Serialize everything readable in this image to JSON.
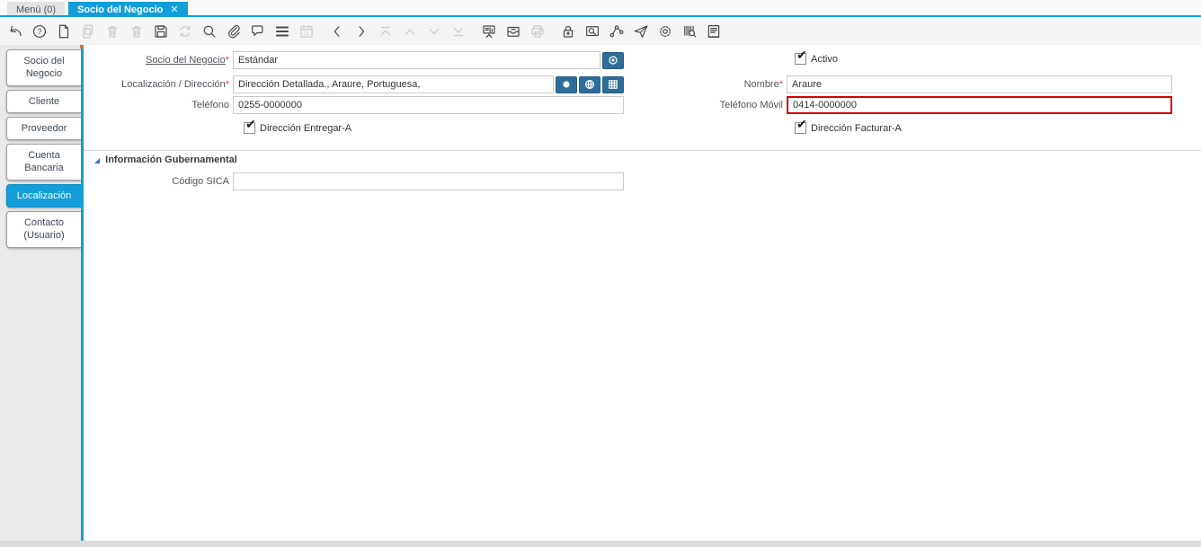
{
  "window": {
    "tabs": [
      {
        "label": "Menú (0)",
        "active": false
      },
      {
        "label": "Socio del Negocio",
        "active": true
      }
    ],
    "close_glyph": "✕"
  },
  "toolbar": {
    "icons": [
      {
        "name": "undo",
        "disabled": false
      },
      {
        "name": "help",
        "disabled": false
      },
      {
        "name": "new-record",
        "disabled": false
      },
      {
        "name": "copy-record",
        "disabled": true
      },
      {
        "name": "delete-record",
        "disabled": true
      },
      {
        "name": "delete-selection",
        "disabled": true
      },
      {
        "name": "save",
        "disabled": false
      },
      {
        "name": "refresh",
        "disabled": true
      },
      {
        "name": "find",
        "disabled": false
      },
      {
        "name": "attachment",
        "disabled": false
      },
      {
        "name": "chat",
        "disabled": false
      },
      {
        "name": "toggle-grid",
        "disabled": false
      },
      {
        "name": "calendar",
        "disabled": true
      },
      {
        "name": "previous-record",
        "disabled": false
      },
      {
        "name": "next-record",
        "disabled": false
      },
      {
        "name": "first-record",
        "disabled": true
      },
      {
        "name": "parent-record",
        "disabled": true
      },
      {
        "name": "detail-record",
        "disabled": true
      },
      {
        "name": "last-record",
        "disabled": true
      },
      {
        "name": "process",
        "disabled": false
      },
      {
        "name": "archive",
        "disabled": false
      },
      {
        "name": "print",
        "disabled": true
      },
      {
        "name": "lock",
        "disabled": false
      },
      {
        "name": "zoom-across",
        "disabled": false
      },
      {
        "name": "workflow",
        "disabled": false
      },
      {
        "name": "requests",
        "disabled": false
      },
      {
        "name": "preferences",
        "disabled": false
      },
      {
        "name": "product-info",
        "disabled": false
      },
      {
        "name": "report",
        "disabled": false
      }
    ]
  },
  "sidebar": {
    "tabs": [
      {
        "label": "Socio del Negocio",
        "active": false
      },
      {
        "label": "Cliente",
        "active": false
      },
      {
        "label": "Proveedor",
        "active": false
      },
      {
        "label": "Cuenta Bancaria",
        "active": false
      },
      {
        "label": "Localización",
        "active": true
      },
      {
        "label": "Contacto (Usuario)",
        "active": false
      }
    ]
  },
  "form": {
    "left": {
      "business_partner": {
        "label": "Socio del Negocio",
        "required": "*",
        "value": "Estándar"
      },
      "location": {
        "label": "Localización / Dirección",
        "required": "*",
        "value": "Dirección Detallada., Araure, Portuguesa,"
      },
      "phone": {
        "label": "Teléfono",
        "value": "0255-0000000"
      },
      "ship_address": {
        "label": "Dirección Entregar-A",
        "checked": true
      }
    },
    "right": {
      "active": {
        "label": "Activo",
        "checked": true
      },
      "name": {
        "label": "Nombre",
        "required": "*",
        "value": "Araure"
      },
      "mobile": {
        "label": "Teléfono Móvil",
        "value": "0414-0000000",
        "highlighted": true
      },
      "invoice_address": {
        "label": "Dirección Facturar-A",
        "checked": true
      }
    },
    "section": {
      "title": "Información Gubernamental",
      "sica": {
        "label": "Código SICA",
        "value": ""
      }
    },
    "check_glyph": "✔"
  },
  "colors": {
    "accent_blue": "#139ed9",
    "field_button_blue": "#2e6d99",
    "highlight_red": "#d50000",
    "required_red": "#e04343"
  }
}
